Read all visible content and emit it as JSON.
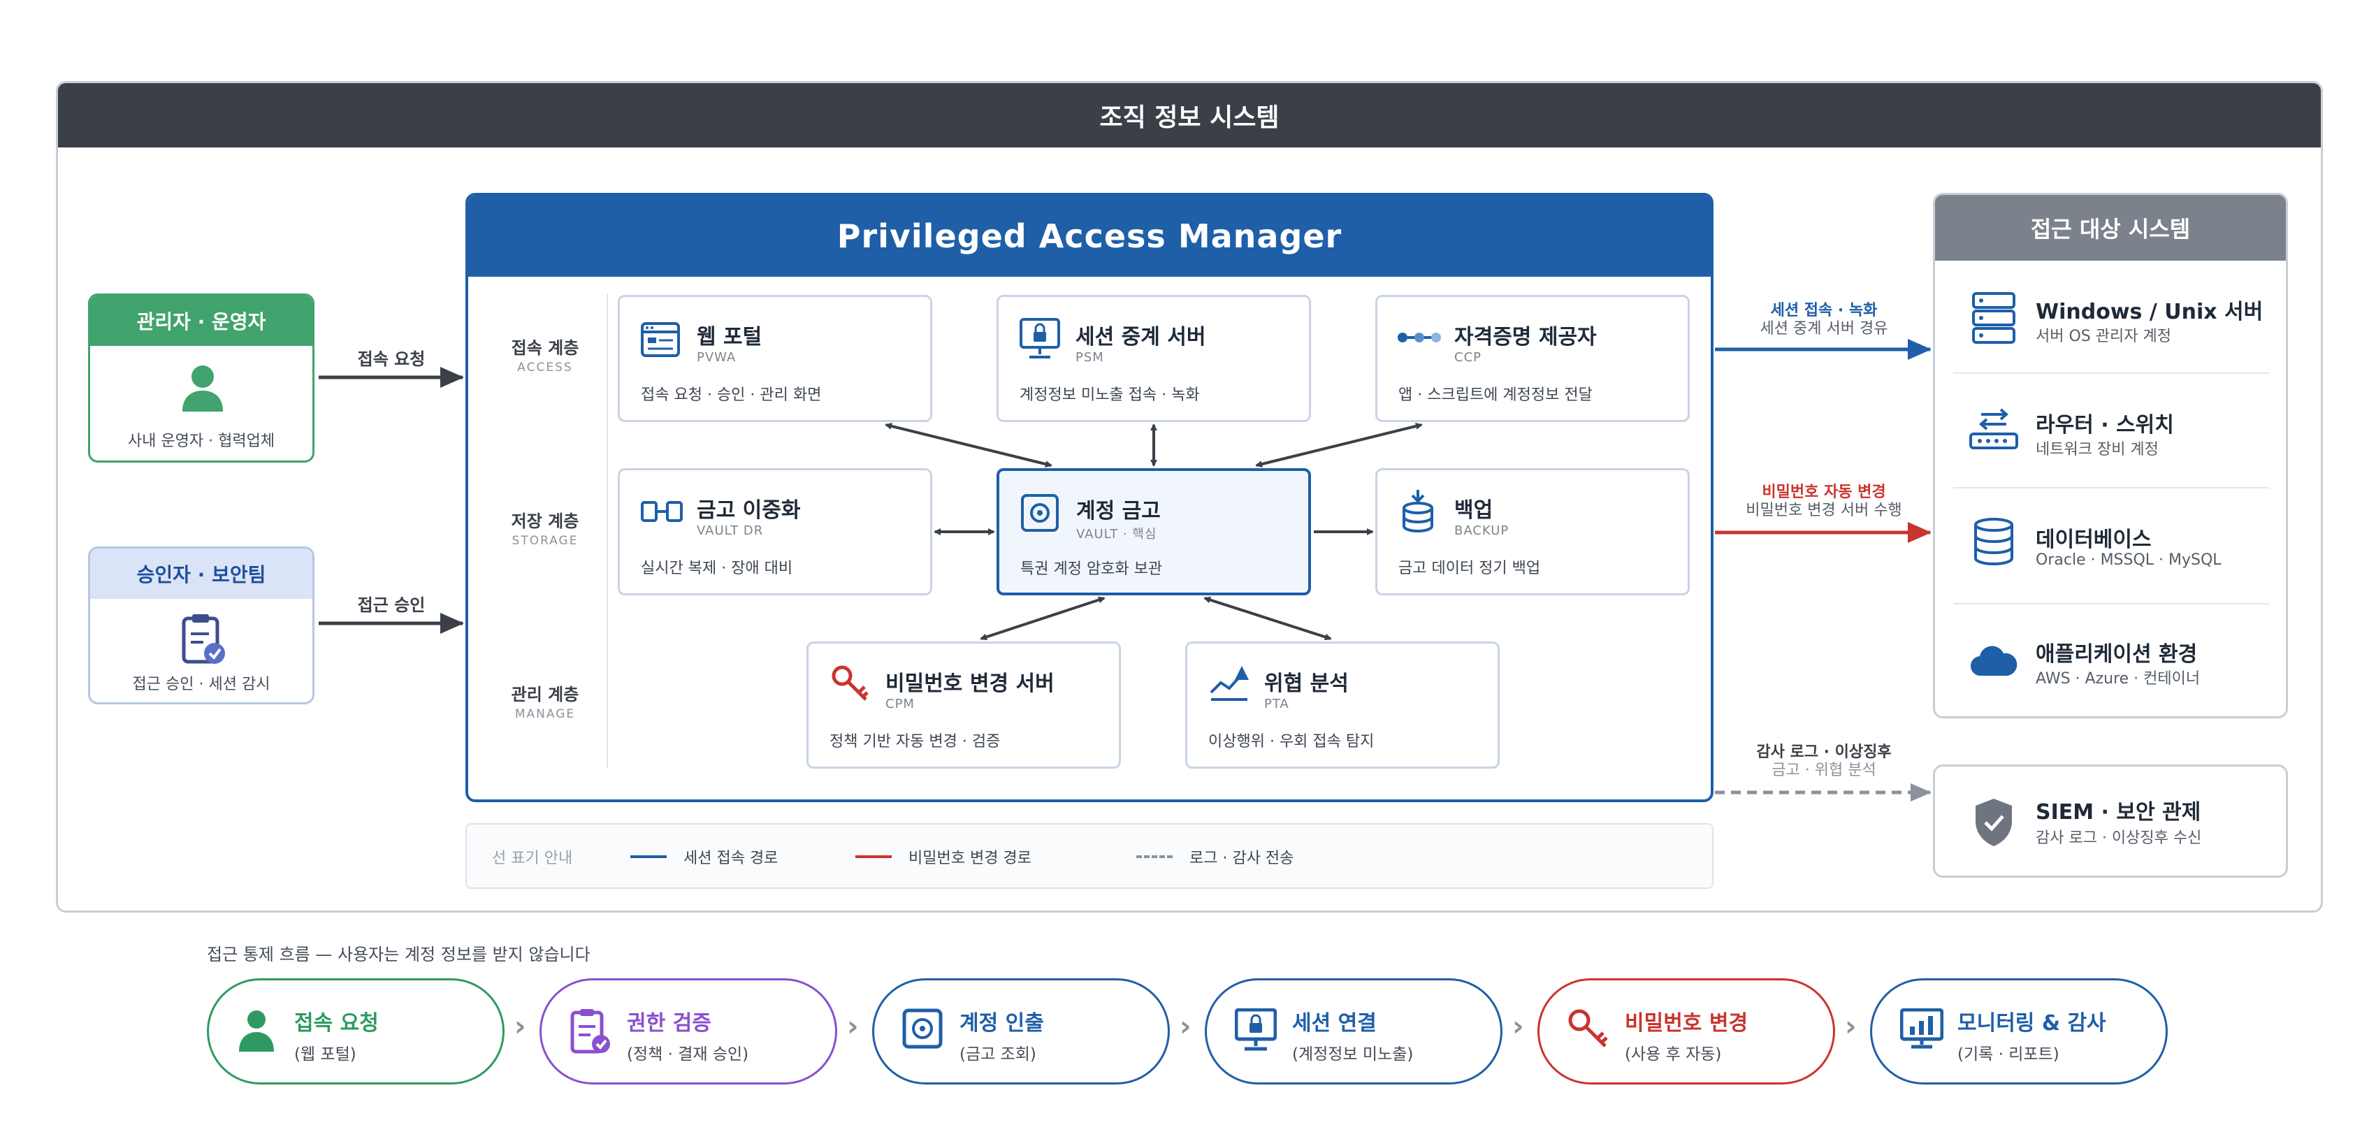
{
  "org_title": "조직 정보 시스템",
  "actors": {
    "admin": {
      "title": "관리자 · 운영자",
      "desc": "사내 운영자 · 협력업체",
      "arrow_label": "접속 요청"
    },
    "approver": {
      "title": "승인자 · 보안팀",
      "desc": "접근 승인 · 세션 감시",
      "arrow_label": "접근 승인"
    }
  },
  "pam": {
    "title": "Privileged Access Manager",
    "layers": [
      {
        "name": "접속 계층",
        "sub": "ACCESS"
      },
      {
        "name": "저장 계층",
        "sub": "STORAGE"
      },
      {
        "name": "관리 계층",
        "sub": "MANAGE"
      }
    ],
    "components": {
      "pvwa": {
        "title": "웹 포털",
        "code": "PVWA",
        "desc": "접속 요청 · 승인 · 관리 화면"
      },
      "psm": {
        "title": "세션 중계 서버",
        "code": "PSM",
        "desc": "계정정보 미노출 접속 · 녹화"
      },
      "ccp": {
        "title": "자격증명 제공자",
        "code": "CCP",
        "desc": "앱 · 스크립트에 계정정보 전달"
      },
      "vaultdr": {
        "title": "금고 이중화",
        "code": "VAULT DR",
        "desc": "실시간 복제 · 장애 대비"
      },
      "vault": {
        "title": "계정 금고",
        "code": "VAULT · 핵심",
        "desc": "특권 계정 암호화 보관"
      },
      "backup": {
        "title": "백업",
        "code": "BACKUP",
        "desc": "금고 데이터 정기 백업"
      },
      "cpm": {
        "title": "비밀번호 변경 서버",
        "code": "CPM",
        "desc": "정책 기반 자동 변경 · 검증"
      },
      "pta": {
        "title": "위협 분석",
        "code": "PTA",
        "desc": "이상행위 · 우회 접속 탐지"
      }
    }
  },
  "legend": {
    "title": "선 표기 안내",
    "session": "세션 접속 경로",
    "password": "비밀번호 변경 경로",
    "log": "로그 · 감사 전송"
  },
  "connectors": {
    "session": {
      "line1": "세션 접속 · 녹화",
      "line2": "세션 중계 서버 경유"
    },
    "password": {
      "line1": "비밀번호 자동 변경",
      "line2": "비밀번호 변경 서버 수행"
    },
    "log": {
      "line1": "감사 로그 · 이상징후",
      "line2": "금고 · 위협 분석"
    }
  },
  "targets": {
    "title": "접근 대상 시스템",
    "items": [
      {
        "title": "Windows / Unix 서버",
        "desc": "서버 OS 관리자 계정"
      },
      {
        "title": "라우터 · 스위치",
        "desc": "네트워크 장비 계정"
      },
      {
        "title": "데이터베이스",
        "desc": "Oracle · MSSQL · MySQL"
      },
      {
        "title": "애플리케이션 환경",
        "desc": "AWS · Azure · 컨테이너"
      }
    ]
  },
  "siem": {
    "title": "SIEM · 보안 관제",
    "desc": "감사 로그 · 이상징후 수신"
  },
  "flow": {
    "caption": "접근 통제 흐름 — 사용자는 계정 정보를 받지 않습니다",
    "steps": [
      {
        "title": "접속 요청",
        "desc": "(웹 포털)"
      },
      {
        "title": "권한 검증",
        "desc": "(정책 · 결재 승인)"
      },
      {
        "title": "계정 인출",
        "desc": "(금고 조회)"
      },
      {
        "title": "세션 연결",
        "desc": "(계정정보 미노출)"
      },
      {
        "title": "비밀번호 변경",
        "desc": "(사용 후 자동)"
      },
      {
        "title": "모니터링 & 감사",
        "desc": "(기록 · 리포트)"
      }
    ]
  },
  "colors": {
    "blue": "#1e5fa8",
    "red": "#c9342e",
    "green": "#41a36d",
    "purple": "#8a4fcf",
    "gray": "#8c929c",
    "dark": "#3b4048"
  }
}
